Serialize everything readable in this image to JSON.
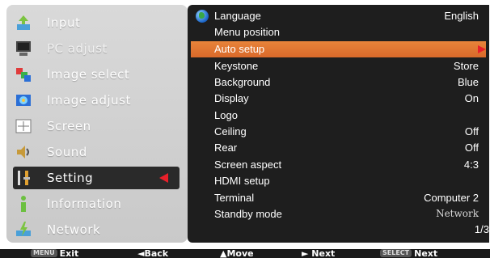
{
  "left_menu": [
    {
      "label": "Input",
      "icon": "input-icon"
    },
    {
      "label": "PC adjust",
      "icon": "pc-adjust-icon"
    },
    {
      "label": "Image select",
      "icon": "image-select-icon"
    },
    {
      "label": "Image adjust",
      "icon": "image-adjust-icon"
    },
    {
      "label": "Screen",
      "icon": "screen-icon"
    },
    {
      "label": "Sound",
      "icon": "sound-icon"
    },
    {
      "label": "Setting",
      "icon": "setting-icon"
    },
    {
      "label": "Information",
      "icon": "information-icon"
    },
    {
      "label": "Network",
      "icon": "network-icon"
    }
  ],
  "selected_menu_index": 6,
  "settings": [
    {
      "label": "Language",
      "value": "English"
    },
    {
      "label": "Menu position",
      "value": ""
    },
    {
      "label": "Auto setup",
      "value": ""
    },
    {
      "label": "Keystone",
      "value": "Store"
    },
    {
      "label": "Background",
      "value": "Blue"
    },
    {
      "label": "Display",
      "value": "On"
    },
    {
      "label": "Logo",
      "value": ""
    },
    {
      "label": "Ceiling",
      "value": "Off"
    },
    {
      "label": "Rear",
      "value": "Off"
    },
    {
      "label": "Screen aspect",
      "value": "4:3"
    },
    {
      "label": "HDMI setup",
      "value": ""
    },
    {
      "label": "Terminal",
      "value": "Computer 2"
    },
    {
      "label": "Standby mode",
      "value": "Network"
    }
  ],
  "highlighted_setting_index": 2,
  "page_indicator": "1/3",
  "bottom_hints": {
    "exit_key": "MENU",
    "exit": "Exit",
    "back": "◄Back",
    "move": "▲Move",
    "next_arrow": "► Next",
    "select_key": "SELECT",
    "select_next": "Next"
  },
  "colors": {
    "highlight": "#e07a33",
    "arrow": "#e8202a",
    "panel_dark": "#1e1e1e",
    "panel_light": "#d2d2d2"
  }
}
